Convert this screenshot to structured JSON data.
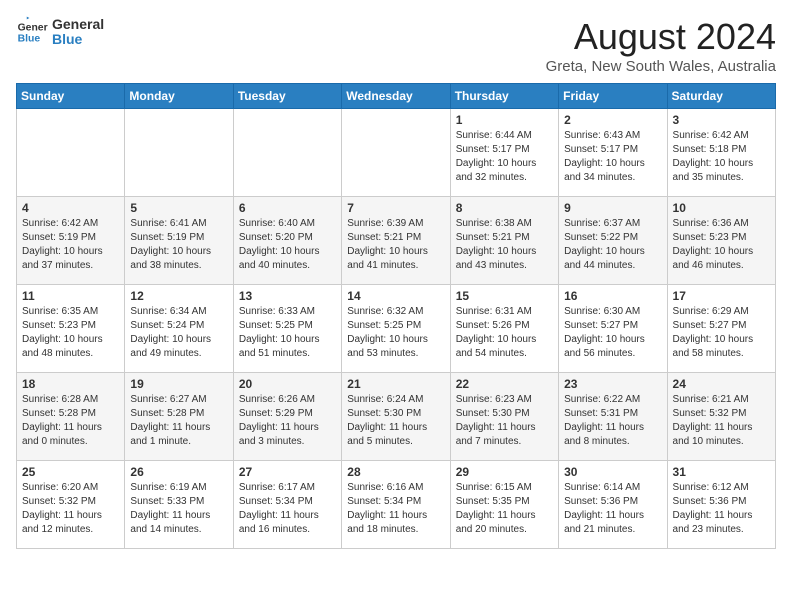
{
  "logo": {
    "line1": "General",
    "line2": "Blue"
  },
  "title": "August 2024",
  "location": "Greta, New South Wales, Australia",
  "days_of_week": [
    "Sunday",
    "Monday",
    "Tuesday",
    "Wednesday",
    "Thursday",
    "Friday",
    "Saturday"
  ],
  "weeks": [
    [
      {
        "day": "",
        "info": ""
      },
      {
        "day": "",
        "info": ""
      },
      {
        "day": "",
        "info": ""
      },
      {
        "day": "",
        "info": ""
      },
      {
        "day": "1",
        "info": "Sunrise: 6:44 AM\nSunset: 5:17 PM\nDaylight: 10 hours\nand 32 minutes."
      },
      {
        "day": "2",
        "info": "Sunrise: 6:43 AM\nSunset: 5:17 PM\nDaylight: 10 hours\nand 34 minutes."
      },
      {
        "day": "3",
        "info": "Sunrise: 6:42 AM\nSunset: 5:18 PM\nDaylight: 10 hours\nand 35 minutes."
      }
    ],
    [
      {
        "day": "4",
        "info": "Sunrise: 6:42 AM\nSunset: 5:19 PM\nDaylight: 10 hours\nand 37 minutes."
      },
      {
        "day": "5",
        "info": "Sunrise: 6:41 AM\nSunset: 5:19 PM\nDaylight: 10 hours\nand 38 minutes."
      },
      {
        "day": "6",
        "info": "Sunrise: 6:40 AM\nSunset: 5:20 PM\nDaylight: 10 hours\nand 40 minutes."
      },
      {
        "day": "7",
        "info": "Sunrise: 6:39 AM\nSunset: 5:21 PM\nDaylight: 10 hours\nand 41 minutes."
      },
      {
        "day": "8",
        "info": "Sunrise: 6:38 AM\nSunset: 5:21 PM\nDaylight: 10 hours\nand 43 minutes."
      },
      {
        "day": "9",
        "info": "Sunrise: 6:37 AM\nSunset: 5:22 PM\nDaylight: 10 hours\nand 44 minutes."
      },
      {
        "day": "10",
        "info": "Sunrise: 6:36 AM\nSunset: 5:23 PM\nDaylight: 10 hours\nand 46 minutes."
      }
    ],
    [
      {
        "day": "11",
        "info": "Sunrise: 6:35 AM\nSunset: 5:23 PM\nDaylight: 10 hours\nand 48 minutes."
      },
      {
        "day": "12",
        "info": "Sunrise: 6:34 AM\nSunset: 5:24 PM\nDaylight: 10 hours\nand 49 minutes."
      },
      {
        "day": "13",
        "info": "Sunrise: 6:33 AM\nSunset: 5:25 PM\nDaylight: 10 hours\nand 51 minutes."
      },
      {
        "day": "14",
        "info": "Sunrise: 6:32 AM\nSunset: 5:25 PM\nDaylight: 10 hours\nand 53 minutes."
      },
      {
        "day": "15",
        "info": "Sunrise: 6:31 AM\nSunset: 5:26 PM\nDaylight: 10 hours\nand 54 minutes."
      },
      {
        "day": "16",
        "info": "Sunrise: 6:30 AM\nSunset: 5:27 PM\nDaylight: 10 hours\nand 56 minutes."
      },
      {
        "day": "17",
        "info": "Sunrise: 6:29 AM\nSunset: 5:27 PM\nDaylight: 10 hours\nand 58 minutes."
      }
    ],
    [
      {
        "day": "18",
        "info": "Sunrise: 6:28 AM\nSunset: 5:28 PM\nDaylight: 11 hours\nand 0 minutes."
      },
      {
        "day": "19",
        "info": "Sunrise: 6:27 AM\nSunset: 5:28 PM\nDaylight: 11 hours\nand 1 minute."
      },
      {
        "day": "20",
        "info": "Sunrise: 6:26 AM\nSunset: 5:29 PM\nDaylight: 11 hours\nand 3 minutes."
      },
      {
        "day": "21",
        "info": "Sunrise: 6:24 AM\nSunset: 5:30 PM\nDaylight: 11 hours\nand 5 minutes."
      },
      {
        "day": "22",
        "info": "Sunrise: 6:23 AM\nSunset: 5:30 PM\nDaylight: 11 hours\nand 7 minutes."
      },
      {
        "day": "23",
        "info": "Sunrise: 6:22 AM\nSunset: 5:31 PM\nDaylight: 11 hours\nand 8 minutes."
      },
      {
        "day": "24",
        "info": "Sunrise: 6:21 AM\nSunset: 5:32 PM\nDaylight: 11 hours\nand 10 minutes."
      }
    ],
    [
      {
        "day": "25",
        "info": "Sunrise: 6:20 AM\nSunset: 5:32 PM\nDaylight: 11 hours\nand 12 minutes."
      },
      {
        "day": "26",
        "info": "Sunrise: 6:19 AM\nSunset: 5:33 PM\nDaylight: 11 hours\nand 14 minutes."
      },
      {
        "day": "27",
        "info": "Sunrise: 6:17 AM\nSunset: 5:34 PM\nDaylight: 11 hours\nand 16 minutes."
      },
      {
        "day": "28",
        "info": "Sunrise: 6:16 AM\nSunset: 5:34 PM\nDaylight: 11 hours\nand 18 minutes."
      },
      {
        "day": "29",
        "info": "Sunrise: 6:15 AM\nSunset: 5:35 PM\nDaylight: 11 hours\nand 20 minutes."
      },
      {
        "day": "30",
        "info": "Sunrise: 6:14 AM\nSunset: 5:36 PM\nDaylight: 11 hours\nand 21 minutes."
      },
      {
        "day": "31",
        "info": "Sunrise: 6:12 AM\nSunset: 5:36 PM\nDaylight: 11 hours\nand 23 minutes."
      }
    ]
  ]
}
